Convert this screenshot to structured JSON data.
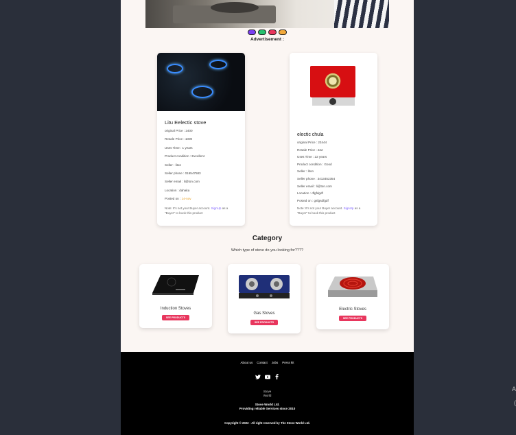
{
  "hero": {
    "image": "kitchen-cooking-photo"
  },
  "carousel": {
    "dots": [
      "#7b3ff2",
      "#25c06d",
      "#e8365d",
      "#f2a93b"
    ]
  },
  "ad_label": "Advertisement :",
  "products": [
    {
      "title": "Litu Eelectic stove",
      "original_price": "original Price : 2400",
      "resale_price": "Resale Price : 1000",
      "uses_time": "Uses Time : 1 years",
      "condition": "Product condition : Excellent",
      "seller": "Seller : liton",
      "seller_phone": "Seller phone : 016547583",
      "seller_email": "Seller email : li@ton.com",
      "location": "Location : dahaka",
      "posted_label": "Posted on : ",
      "posted_value": "14-nov",
      "note_pre": "Note: It's not your Buyer account.",
      "note_link": "SignUp",
      "note_post": "as a \"Buyer\" to book this product"
    },
    {
      "title": "electic chula",
      "original_price": "original Price : 23444",
      "resale_price": "Resale Price : 222",
      "uses_time": "Uses Time : 22 years",
      "condition": "Product condition : Good",
      "seller": "Seller : liton",
      "seller_phone": "Seller phone : 3413452354",
      "seller_email": "Seller email : li@ton.com",
      "location": "Location : dfgfdgdf",
      "posted_label": "Posted on : ",
      "posted_value": "gsfgsdfgdf",
      "note_pre": "Note: It's not your Buyer account.",
      "note_link": "SignUp",
      "note_post": "as a \"Buyer\" to book this product"
    }
  ],
  "category": {
    "title": "Category",
    "subtitle": "Which type of stove do you looking for????",
    "items": [
      {
        "name": "Induction Stoves",
        "button": "SEE PRODUCTS"
      },
      {
        "name": "Gas Stoves",
        "button": "SEE PRODUCTS"
      },
      {
        "name": "Electric Stoves",
        "button": "SEE PRODUCTS"
      }
    ]
  },
  "footer": {
    "nav": [
      "About us",
      "Contact",
      "Jobs",
      "Press kit"
    ],
    "social": [
      "twitter-icon",
      "youtube-icon",
      "facebook-icon"
    ],
    "logo_alt_1": "Stove",
    "logo_alt_2": "World",
    "company": "Stove World Ltd.",
    "tagline": "Providing reliable Services since 2010",
    "copyright": "Copyright © 2022 - All right reserved by The Stove World Ltd."
  },
  "edge_marks": {
    "top": "A",
    "bottom": "("
  },
  "colors": {
    "accent_button": "#e8365d",
    "footer_bg": "#000000",
    "page_bg": "#fbf6f3",
    "link": "#7d5fff"
  }
}
